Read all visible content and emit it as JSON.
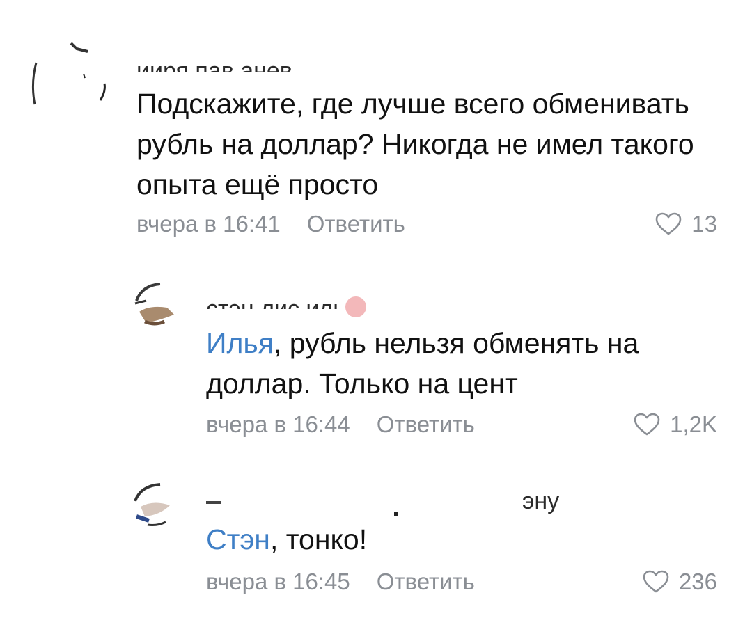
{
  "comments": [
    {
      "author_fragment": "ииря пав    анев",
      "text": "Подскажите, где лучше всего обменивать рубль на доллар? Никогда не имел такого опыта ещё просто",
      "time": "вчера в 16:41",
      "reply_label": "Ответить",
      "likes": "13"
    },
    {
      "author_fragment": "стэн лис     илье",
      "mention": "Илья",
      "text": ", рубль нельзя обменять на доллар. Только на цент",
      "time": "вчера в 16:44",
      "reply_label": "Ответить",
      "likes": "1,2K"
    },
    {
      "author_fragment": "эну",
      "mention": "Стэн",
      "text": ", тонко!",
      "time": "вчера в 16:45",
      "reply_label": "Ответить",
      "likes": "236"
    }
  ],
  "colors": {
    "mention": "#3f7fc6",
    "meta": "#8a8e94",
    "text": "#111111"
  },
  "icons": {
    "like": "heart-outline-icon"
  }
}
